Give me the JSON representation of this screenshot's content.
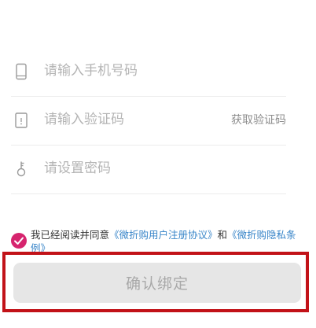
{
  "form": {
    "phone": {
      "placeholder": "请输入手机号码",
      "icon": "phone-icon"
    },
    "code": {
      "placeholder": "请输入验证码",
      "action_label": "获取验证码",
      "icon": "verification-code-icon"
    },
    "password": {
      "placeholder": "请设置密码",
      "icon": "key-icon"
    }
  },
  "agreement": {
    "checked": true,
    "prefix": "我已经阅读并同意",
    "user_agreement_link": "《微折购用户注册协议》",
    "connector": "和",
    "privacy_link": "《微折购隐私条例》"
  },
  "confirm_button": {
    "label": "确认绑定"
  },
  "colors": {
    "accent": "#d6246e",
    "link": "#3a86c9",
    "highlight_border": "#c21218",
    "button_disabled_bg": "#e6e6e6"
  }
}
